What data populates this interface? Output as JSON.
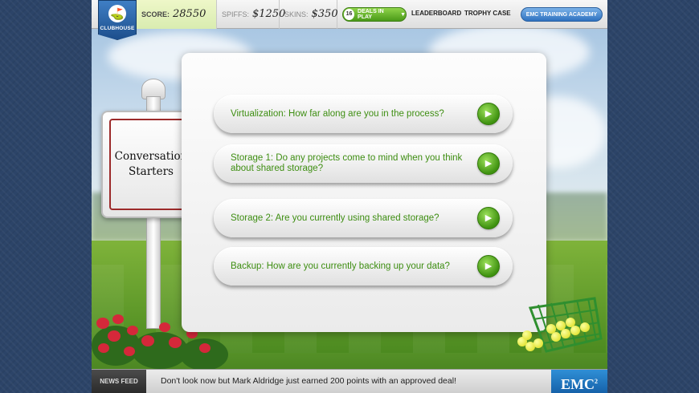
{
  "header": {
    "clubhouse_label": "CLUBHOUSE",
    "score_label": "SCORE:",
    "score_value": "28550",
    "spiffs_label": "SPIFFS:",
    "spiffs_value": "$1250",
    "skins_label": "SKINS:",
    "skins_value": "$350",
    "deals_count": "16",
    "deals_label": "DEALS IN PLAY",
    "leaderboard_label": "LEADERBOARD",
    "trophy_label": "TROPHY CASE",
    "academy_label": "EMC TRAINING ACADEMY"
  },
  "sign": {
    "line1": "Conversation",
    "line2": "Starters"
  },
  "questions": [
    {
      "text": "Virtualization: How far along are you in the process?"
    },
    {
      "text": "Storage 1: Do any projects come to mind when you think about shared storage?"
    },
    {
      "text": "Storage 2: Are you currently using shared storage?"
    },
    {
      "text": "Backup: How are you currently backing up your data?"
    }
  ],
  "news": {
    "label": "NEWS FEED",
    "text": "Don't look now but Mark Aldridge just earned 200 points with an approved deal!",
    "logo": "EMC",
    "logo_sup": "2"
  },
  "icons": {
    "clubhouse": "golf-flag-icon",
    "go": "play-arrow-icon",
    "caret": "caret-down-icon"
  },
  "colors": {
    "accent_green": "#3e8e12",
    "brand_blue": "#1d4f8c",
    "sign_border": "#9c2a2a"
  }
}
